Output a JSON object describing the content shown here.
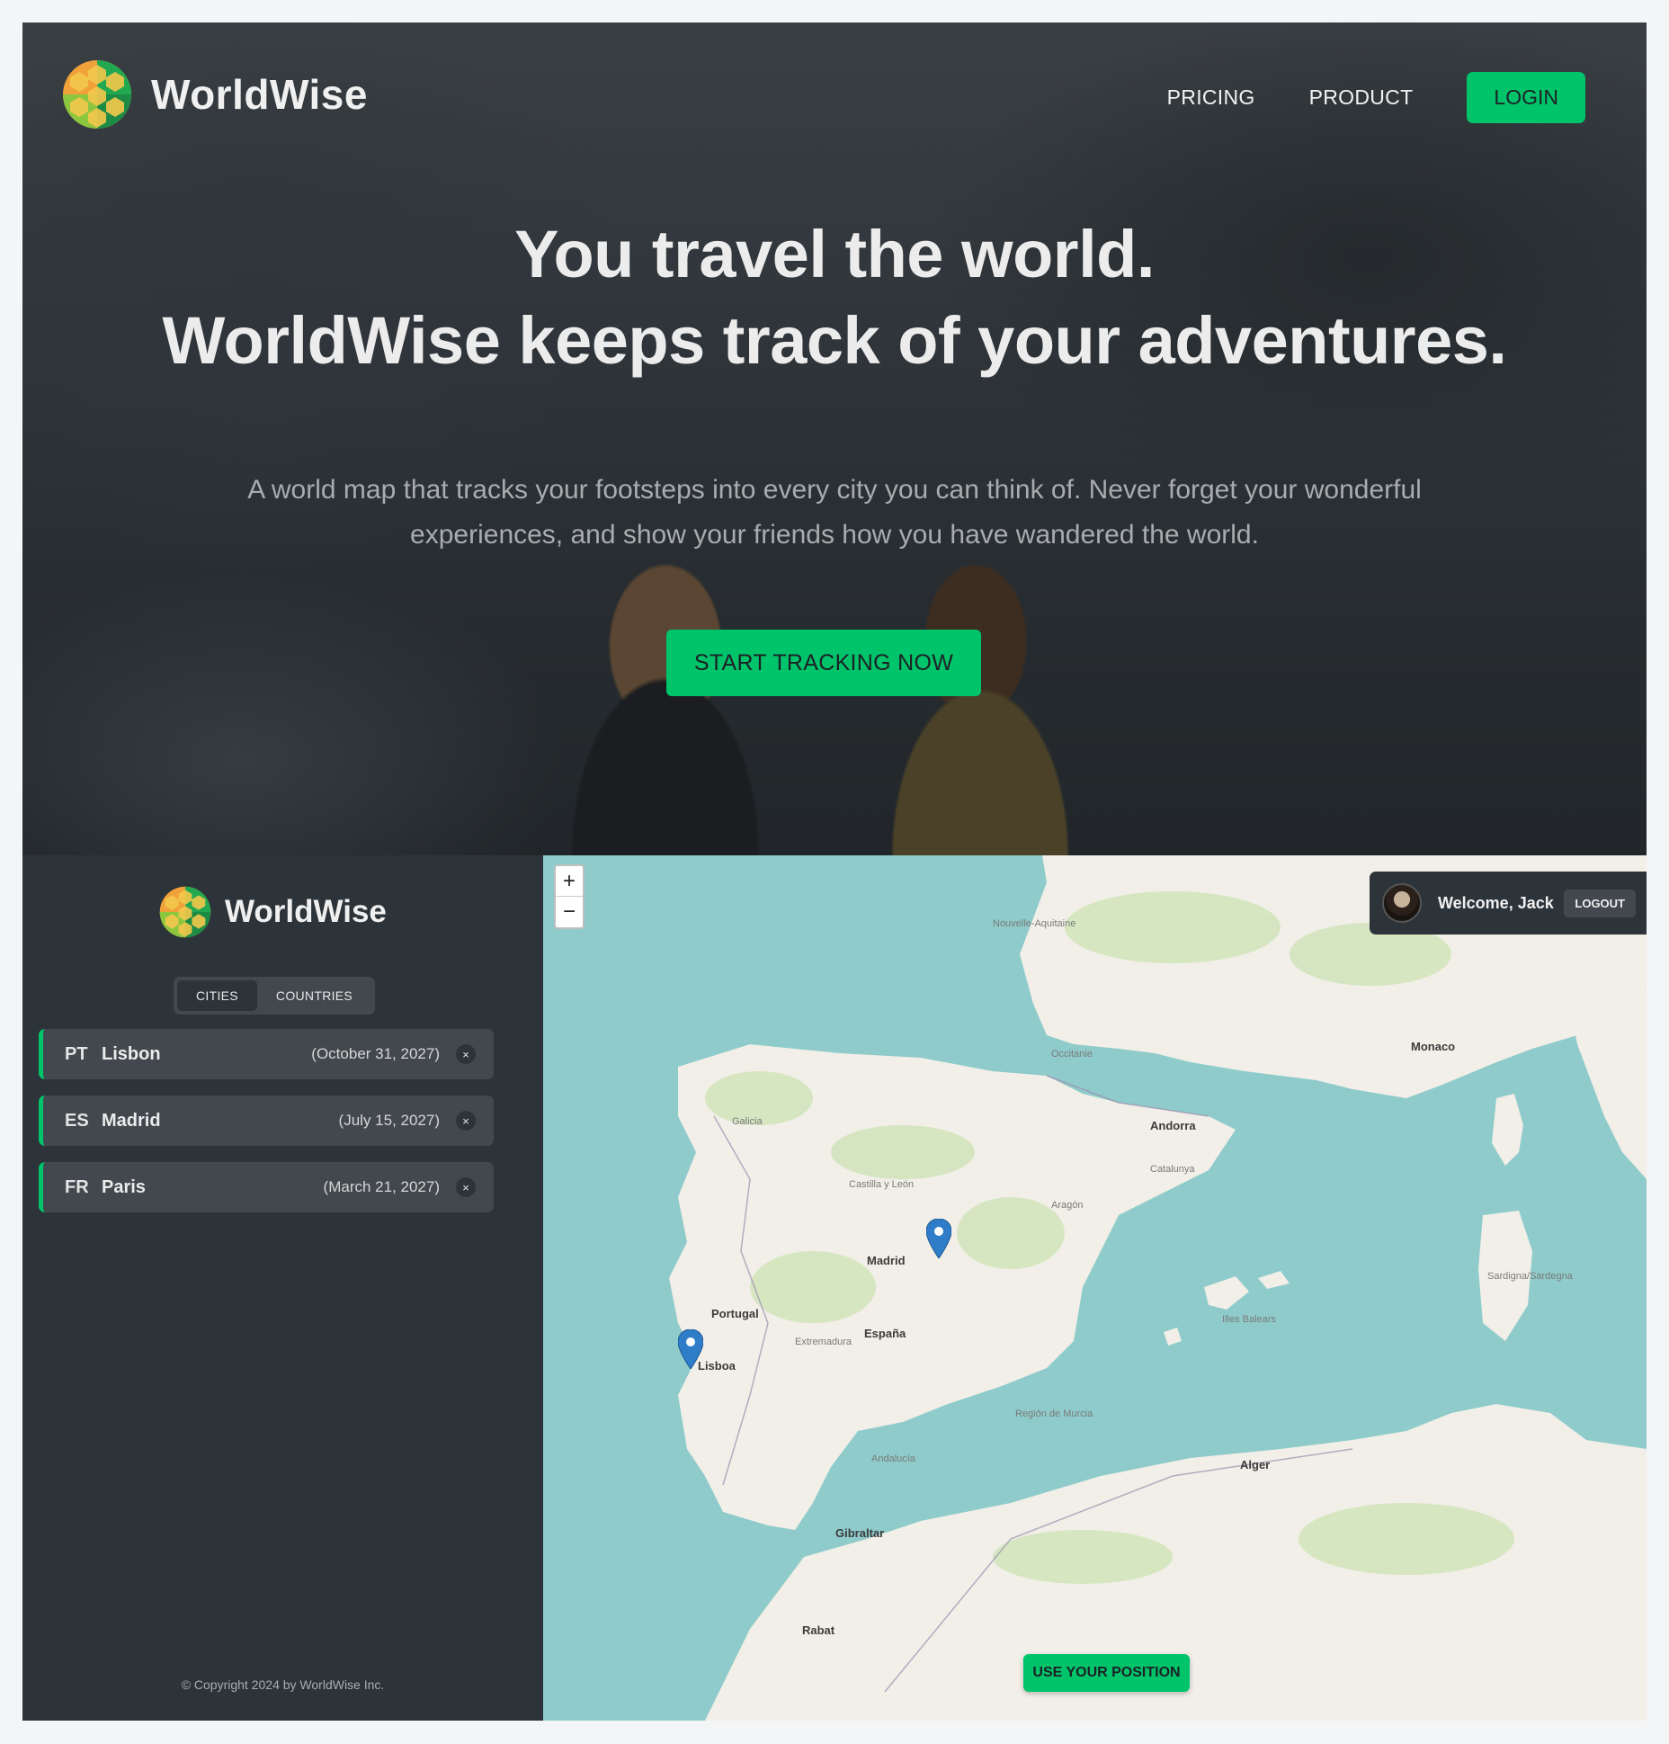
{
  "hero": {
    "brand": "WorldWise",
    "nav": [
      "PRICING",
      "PRODUCT"
    ],
    "login_label": "LOGIN",
    "title_line1": "You travel the world.",
    "title_line2": "WorldWise keeps track of your adventures.",
    "subtitle": "A world map that tracks your footsteps into every city you can think of. Never forget your wonderful experiences, and show your friends how you have wandered the world.",
    "cta_label": "START TRACKING NOW"
  },
  "app": {
    "brand": "WorldWise",
    "tabs": [
      "CITIES",
      "COUNTRIES"
    ],
    "active_tab": "CITIES",
    "cities": [
      {
        "code": "PT",
        "name": "Lisbon",
        "date": "(October 31, 2027)"
      },
      {
        "code": "ES",
        "name": "Madrid",
        "date": "(July 15, 2027)"
      },
      {
        "code": "FR",
        "name": "Paris",
        "date": "(March 21, 2027)"
      }
    ],
    "delete_icon": "×",
    "copyright": "© Copyright 2024 by WorldWise Inc.",
    "map": {
      "zoom_in": "+",
      "zoom_out": "−",
      "welcome": "Welcome, Jack",
      "logout_label": "LOGOUT",
      "use_position_label": "USE YOUR POSITION",
      "labels": {
        "portugal": "Portugal",
        "espana": "España",
        "madrid": "Madrid",
        "lisboa": "Lisboa",
        "andorra": "Andorra",
        "monaco": "Monaco",
        "gibraltar": "Gibraltar",
        "rabat": "Rabat",
        "alger": "Alger",
        "nouvelle": "Nouvelle-Aquitaine",
        "occitanie": "Occitanie",
        "catalunya": "Catalunya",
        "aragon": "Aragón",
        "galicia": "Galicia",
        "castilla": "Castilla y León",
        "extremadura": "Extremadura",
        "andalucia": "Andalucía",
        "illes": "Illes Balears",
        "sardegna": "Sardigna/Sardegna",
        "murcia": "Región de Murcia"
      }
    }
  },
  "colors": {
    "accent": "#00c46a",
    "sidebar": "#2d3439",
    "card": "#42484d",
    "sea": "#8fcbcb",
    "land": "#f2efe6"
  }
}
